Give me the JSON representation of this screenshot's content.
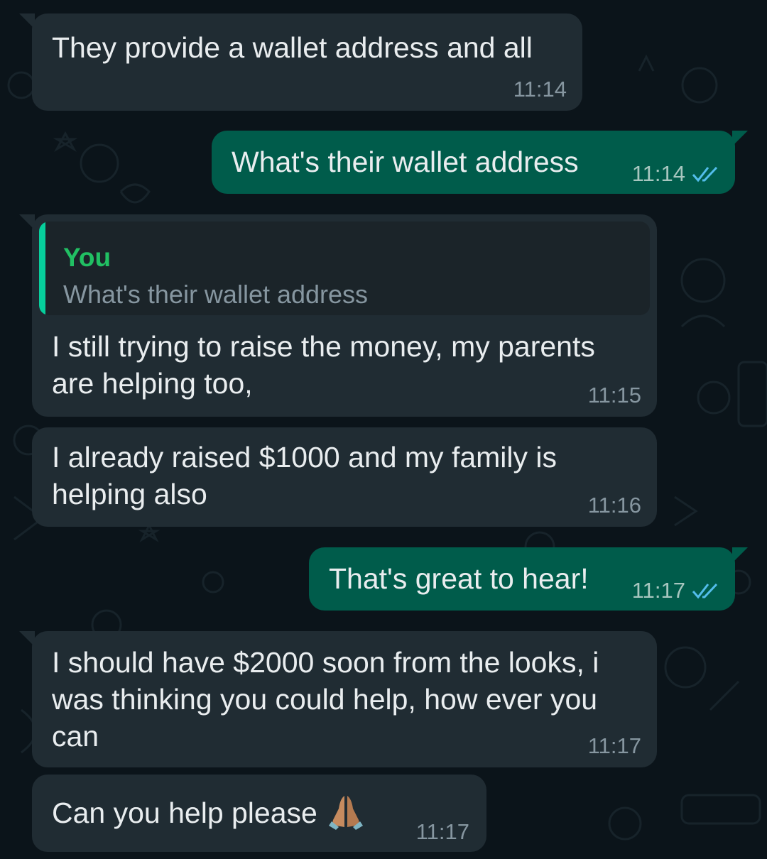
{
  "messages": [
    {
      "direction": "incoming",
      "text": "They provide a wallet address and all",
      "time": "11:14"
    },
    {
      "direction": "outgoing",
      "text": "What's their wallet address",
      "time": "11:14",
      "status": "read"
    },
    {
      "direction": "incoming",
      "reply_to": {
        "author": "You",
        "text": "What's their wallet address"
      },
      "text": "I still trying to raise the money, my parents are helping too,",
      "time": "11:15"
    },
    {
      "direction": "incoming",
      "text": "I already raised $1000 and my family is helping also",
      "time": "11:16"
    },
    {
      "direction": "outgoing",
      "text": "That's great to hear!",
      "time": "11:17",
      "status": "read"
    },
    {
      "direction": "incoming",
      "text": "I should have $2000 soon from the looks, i was thinking you could help, how ever you can",
      "time": "11:17"
    },
    {
      "direction": "incoming",
      "text": "Can you help please",
      "emoji": "folded-hands",
      "time": "11:17"
    }
  ],
  "colors": {
    "background": "#0b141a",
    "incoming_bubble": "#202c33",
    "outgoing_bubble": "#005c4b",
    "quote_accent": "#06cf9c",
    "read_ticks": "#53bdeb"
  }
}
